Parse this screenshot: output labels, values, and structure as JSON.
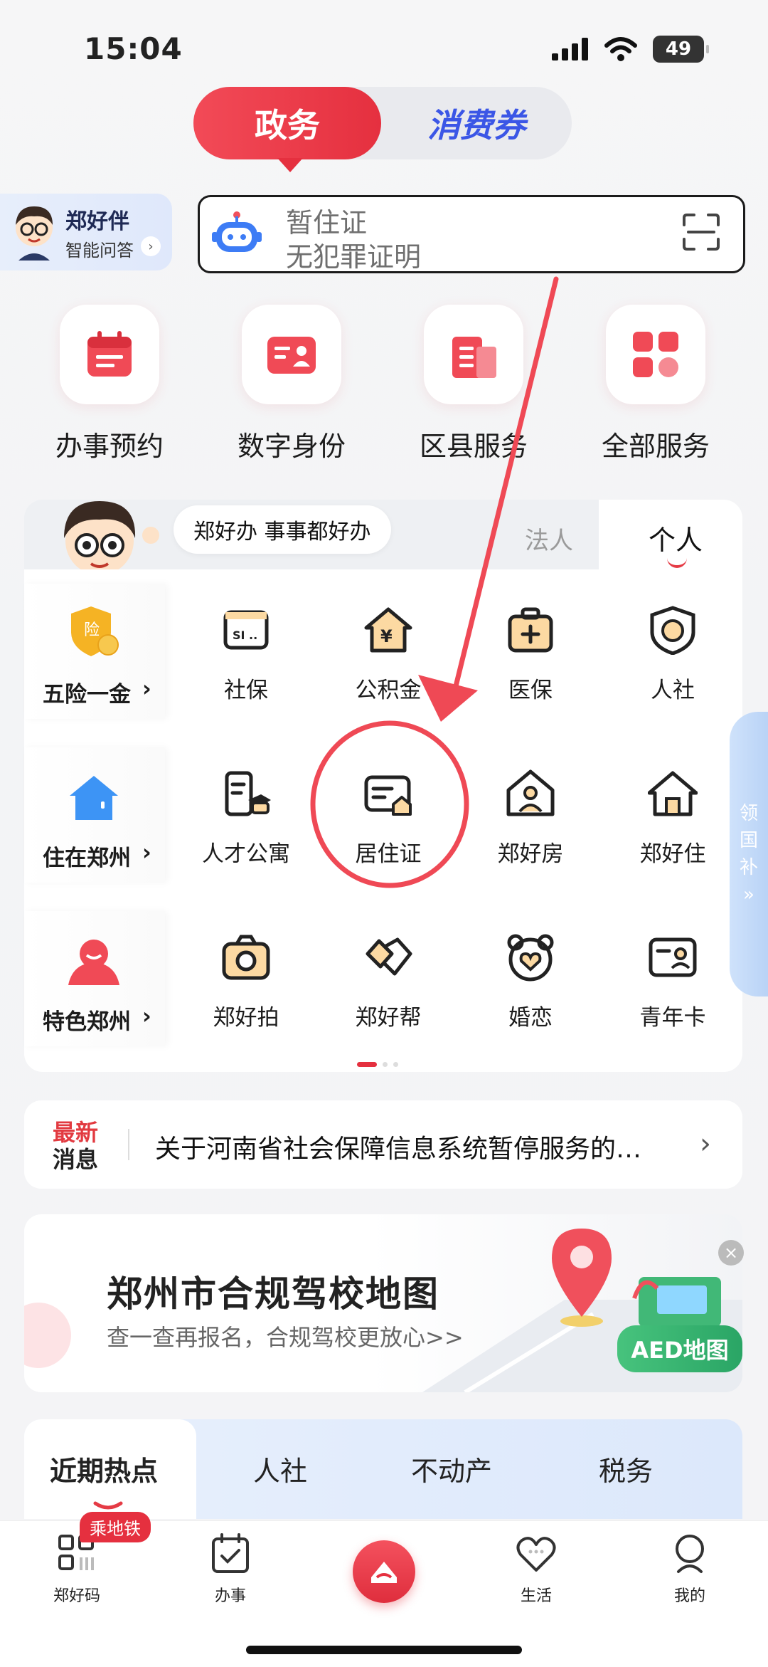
{
  "status": {
    "time": "15:04",
    "battery": "49"
  },
  "toggle": {
    "active": "政务",
    "other": "消费券"
  },
  "assistant": {
    "title": "郑好伴",
    "subtitle": "智能问答"
  },
  "search": {
    "line1": "暂住证",
    "line2": "无犯罪证明"
  },
  "top_services": [
    {
      "label": "办事预约",
      "icon": "calendar-icon"
    },
    {
      "label": "数字身份",
      "icon": "id-card-icon"
    },
    {
      "label": "区县服务",
      "icon": "building-icon"
    },
    {
      "label": "全部服务",
      "icon": "grid-icon"
    }
  ],
  "category": {
    "motto": "郑好办  事事都好办",
    "tab_legal": "法人",
    "tab_personal": "个人"
  },
  "rows": [
    {
      "head": "五险一金",
      "items": [
        "社保",
        "公积金",
        "医保",
        "人社"
      ]
    },
    {
      "head": "住在郑州",
      "items": [
        "人才公寓",
        "居住证",
        "郑好房",
        "郑好住"
      ]
    },
    {
      "head": "特色郑州",
      "items": [
        "郑好拍",
        "郑好帮",
        "婚恋",
        "青年卡"
      ]
    }
  ],
  "side_tab": [
    "领",
    "国",
    "补",
    "»"
  ],
  "news": {
    "tag_top": "最新",
    "tag_bottom": "消息",
    "text": "关于河南省社会保障信息系统暂停服务的…"
  },
  "banner": {
    "title": "郑州市合规驾校地图",
    "subtitle": "查一查再报名，合规驾校更放心>>",
    "aed": "AED地图"
  },
  "hot_tabs": [
    "近期热点",
    "人社",
    "不动产",
    "税务"
  ],
  "bottom_nav": {
    "metro_badge": "乘地铁",
    "items": [
      "郑好码",
      "办事",
      "生活",
      "我的"
    ]
  },
  "colors": {
    "accent": "#E5303F",
    "blue": "#3B56E6"
  }
}
